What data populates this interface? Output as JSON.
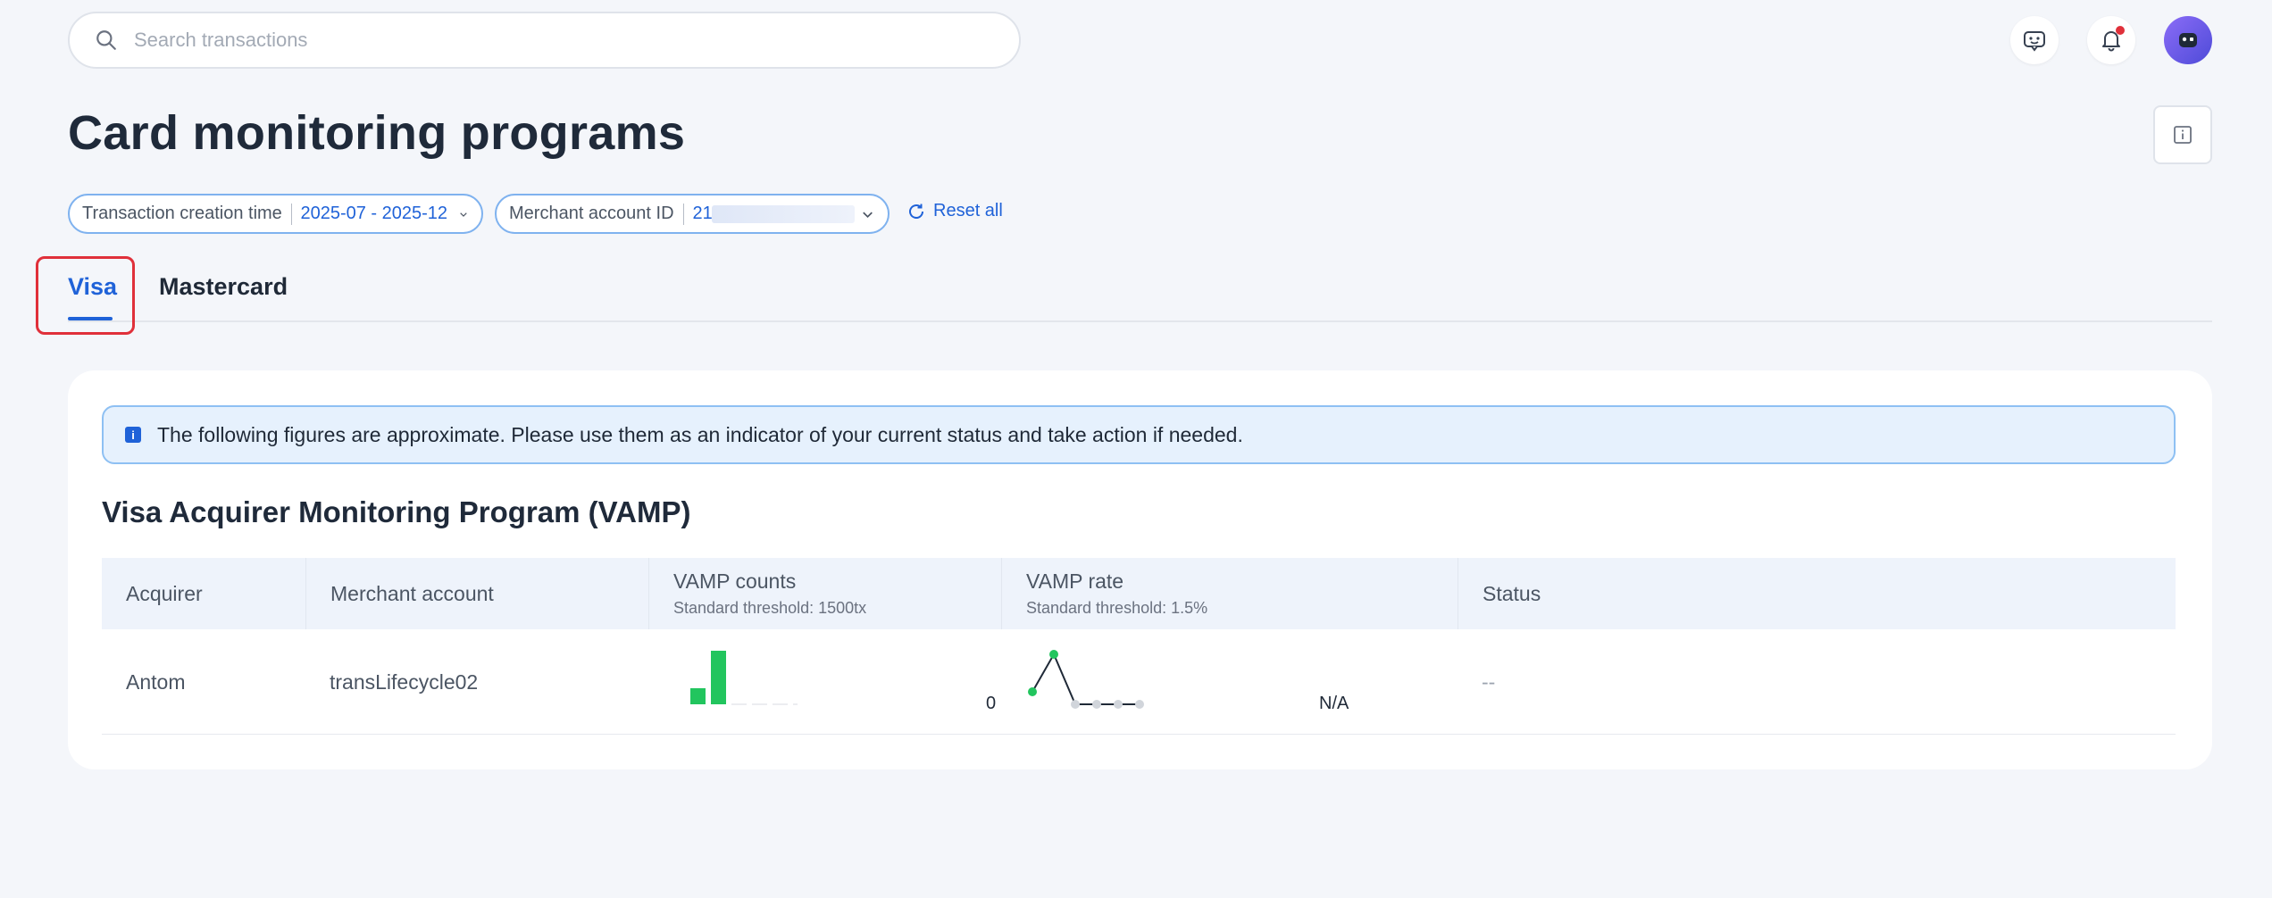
{
  "search": {
    "placeholder": "Search transactions"
  },
  "page": {
    "title": "Card monitoring programs"
  },
  "filters": [
    {
      "label": "Transaction creation time",
      "value": "2025-07 - 2025-12"
    },
    {
      "label": "Merchant account ID",
      "value": "21"
    }
  ],
  "reset_label": "Reset all",
  "tabs": [
    {
      "label": "Visa",
      "active": true
    },
    {
      "label": "Mastercard",
      "active": false
    }
  ],
  "notice": {
    "text": "The following figures are approximate. Please use them as an indicator of your current status and take action if needed.",
    "icon": "i"
  },
  "section": {
    "title": "Visa Acquirer Monitoring Program (VAMP)"
  },
  "table": {
    "columns": [
      {
        "label": "Acquirer",
        "sub": ""
      },
      {
        "label": "Merchant account",
        "sub": ""
      },
      {
        "label": "VAMP counts",
        "sub": "Standard threshold: 1500tx"
      },
      {
        "label": "VAMP rate",
        "sub": "Standard threshold: 1.5%"
      },
      {
        "label": "Status",
        "sub": ""
      }
    ],
    "rows": [
      {
        "acquirer": "Antom",
        "merchant": "transLifecycle02",
        "counts_value": "0",
        "rate_value": "N/A",
        "status": "--"
      }
    ]
  },
  "sparklines": {
    "counts_bars": [
      0.3,
      1,
      0,
      0,
      0,
      0,
      0
    ],
    "rate_points": [
      0.25,
      1,
      0,
      0,
      0,
      0
    ]
  },
  "colors": {
    "accent": "#1f62d8",
    "success": "#22c55e",
    "alert": "#e0303a"
  }
}
